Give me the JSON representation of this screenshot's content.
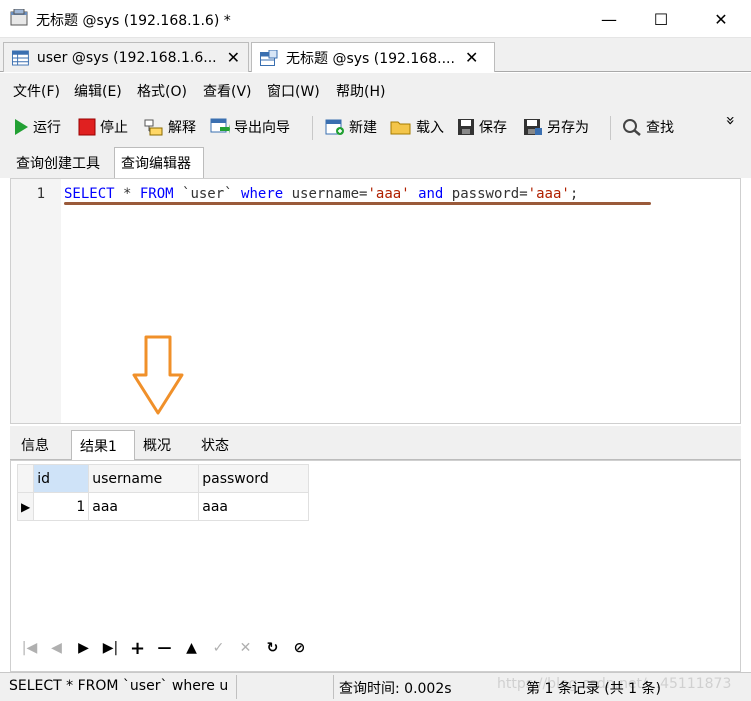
{
  "window": {
    "title": "无标题 @sys (192.168.1.6) *",
    "minimize": "—",
    "maximize": "☐",
    "close": "✕"
  },
  "doc_tabs": [
    {
      "label": "user @sys (192.168.1.6...",
      "close": "✕"
    },
    {
      "label": "无标题 @sys (192.168....",
      "close": "✕"
    }
  ],
  "menu": [
    "文件(F)",
    "编辑(E)",
    "格式(O)",
    "查看(V)",
    "窗口(W)",
    "帮助(H)"
  ],
  "toolbar": {
    "run": "运行",
    "stop": "停止",
    "explain": "解释",
    "export_wizard": "导出向导",
    "new": "新建",
    "load": "载入",
    "save": "保存",
    "save_as": "另存为",
    "find": "查找",
    "more": "»"
  },
  "editor_tabs": [
    "查询创建工具",
    "查询编辑器"
  ],
  "editor": {
    "line_number": "1",
    "tokens": [
      {
        "t": "SELECT",
        "c": "kw"
      },
      {
        "t": " * ",
        "c": "plain"
      },
      {
        "t": "FROM",
        "c": "kw"
      },
      {
        "t": " `user` ",
        "c": "plain"
      },
      {
        "t": "where",
        "c": "kw"
      },
      {
        "t": " username=",
        "c": "plain"
      },
      {
        "t": "'aaa'",
        "c": "str"
      },
      {
        "t": " ",
        "c": "plain"
      },
      {
        "t": "and",
        "c": "kw"
      },
      {
        "t": " password=",
        "c": "plain"
      },
      {
        "t": "'aaa'",
        "c": "str"
      },
      {
        "t": ";",
        "c": "plain"
      }
    ]
  },
  "result_tabs": [
    "信息",
    "结果1",
    "概况",
    "状态"
  ],
  "grid": {
    "columns": [
      "id",
      "username",
      "password"
    ],
    "rows": [
      [
        "1",
        "aaa",
        "aaa"
      ]
    ]
  },
  "navigator": [
    "|◀",
    "◀",
    "▶",
    "▶|",
    "+",
    "—",
    "▲",
    "✓",
    "✕",
    "↻",
    "⊘"
  ],
  "status": {
    "query": "SELECT * FROM `user` where u",
    "time": "查询时间: 0.002s",
    "records": "第 1 条记录 (共 1 条)",
    "watermark": "https://blog.csdn.net/...45111873"
  },
  "colors": {
    "keyword": "#0000ff",
    "string": "#b02000",
    "arrow": "#f0902a",
    "underline": "#9a5a3a"
  }
}
